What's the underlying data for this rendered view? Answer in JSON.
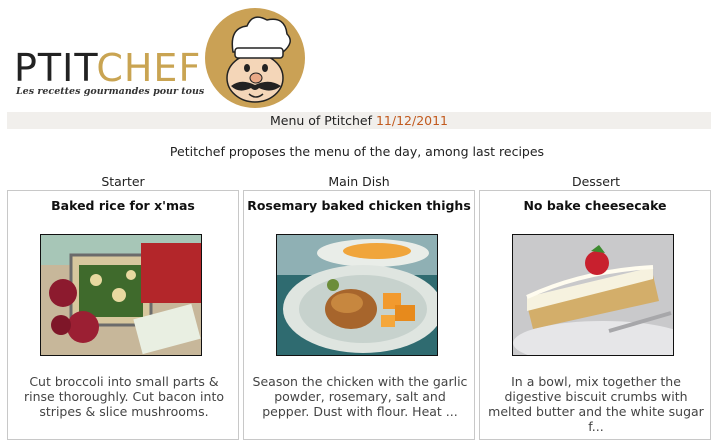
{
  "brand": {
    "name_part1": "PTIT",
    "name_part2": "CHEF",
    "tagline": "Les recettes gourmandes pour tous"
  },
  "menu": {
    "label": "Menu of Ptitchef",
    "date": "11/12/2011",
    "intro": "Petitchef proposes the menu of the day, among last recipes"
  },
  "courses": [
    {
      "category": "Starter",
      "title": "Baked rice for x'mas",
      "description": "Cut broccoli into small parts & rinse thoroughly. Cut bacon into stripes & slice mushrooms."
    },
    {
      "category": "Main Dish",
      "title": "Rosemary baked chicken thighs",
      "description": "Season the chicken with the garlic powder, rosemary, salt and pepper. Dust with flour. Heat ..."
    },
    {
      "category": "Dessert",
      "title": "No bake cheesecake",
      "description": "In a bowl, mix together the digestive biscuit crumbs with melted butter and the white sugar f..."
    }
  ],
  "colors": {
    "accent_gold": "#c9a452",
    "date_color": "#c25a1e",
    "bar_background": "#f1efec"
  }
}
